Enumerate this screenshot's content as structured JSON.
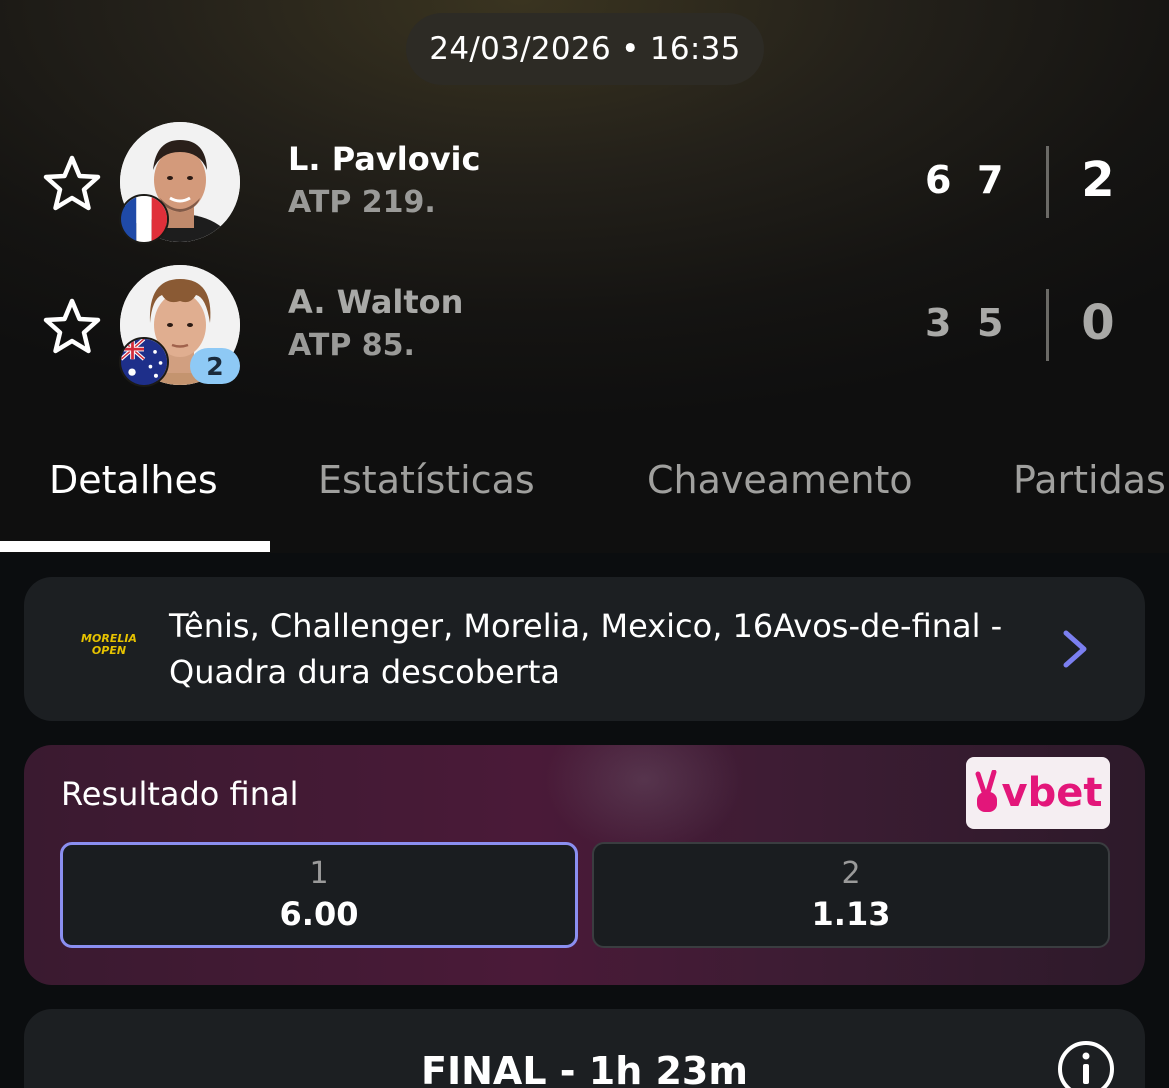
{
  "match": {
    "datetime": "24/03/2026 • 16:35"
  },
  "players": [
    {
      "name": "L. Pavlovic",
      "rank": "ATP 219.",
      "flag": "france-flag",
      "sets": [
        "6",
        "7"
      ],
      "total": "2",
      "seed": ""
    },
    {
      "name": "A. Walton",
      "rank": "ATP 85.",
      "flag": "australia-flag",
      "sets": [
        "3",
        "5"
      ],
      "total": "0",
      "seed": "2"
    }
  ],
  "tabs": [
    {
      "label": "Detalhes",
      "active": true
    },
    {
      "label": "Estatísticas",
      "active": false
    },
    {
      "label": "Chaveamento",
      "active": false
    },
    {
      "label": "Partidas",
      "active": false
    }
  ],
  "tournament": {
    "logo_line1": "MORELIA",
    "logo_line2": "OPEN",
    "line1": "Tênis, Challenger, Morelia, Mexico, 16Avos-de-final -",
    "line2": "Quadra dura descoberta"
  },
  "odds": {
    "title": "Resultado final",
    "bookmaker": "vbet",
    "options": [
      {
        "label": "1",
        "value": "6.00",
        "selected": true
      },
      {
        "label": "2",
        "value": "1.13",
        "selected": false
      }
    ]
  },
  "status": {
    "text": "FINAL - 1h 23m"
  },
  "colors": {
    "background": "#0b0d0f",
    "card": "#1c1f22",
    "accent_selected": "#8b8ff0",
    "seed_badge": "#8ec9f5",
    "bookmaker_brand": "#e3167a",
    "chevron": "#7b7ff0"
  },
  "icons": {
    "favorite": "star-outline-icon",
    "navigate": "chevron-right-icon",
    "info": "info-icon"
  }
}
